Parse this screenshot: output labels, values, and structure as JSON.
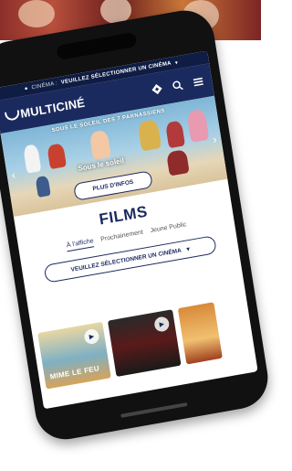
{
  "cinema_bar": {
    "label": "CINÉMA :",
    "value": "VEUILLEZ SÉLECTIONNER UN CINÉMA",
    "pin_icon": "map-pin-icon",
    "chevron_icon": "chevron-down-icon"
  },
  "header": {
    "brand": "MULTICINÉ",
    "icons": [
      "ticket-diamond-icon",
      "search-icon",
      "menu-icon"
    ]
  },
  "banner": {
    "title": "SOUS LE SOLEIL DES 7 PARNASSIENS",
    "subtitle": "Sous le soleil",
    "cta": "PLUS D'INFOS"
  },
  "films": {
    "title": "FILMS",
    "tabs": [
      "À l'affiche",
      "Prochainement",
      "Jeune Public"
    ],
    "active_tab": "À l'affiche",
    "select_label": "VEUILLEZ SÉLECTIONNER UN CINÉMA"
  },
  "posters": [
    {
      "title": "MIME LE FEU"
    },
    {
      "title": ""
    },
    {
      "title": ""
    }
  ],
  "colors": {
    "navy": "#1b2a5e",
    "dark_navy": "#0f1d44",
    "phone_body": "#111111"
  }
}
